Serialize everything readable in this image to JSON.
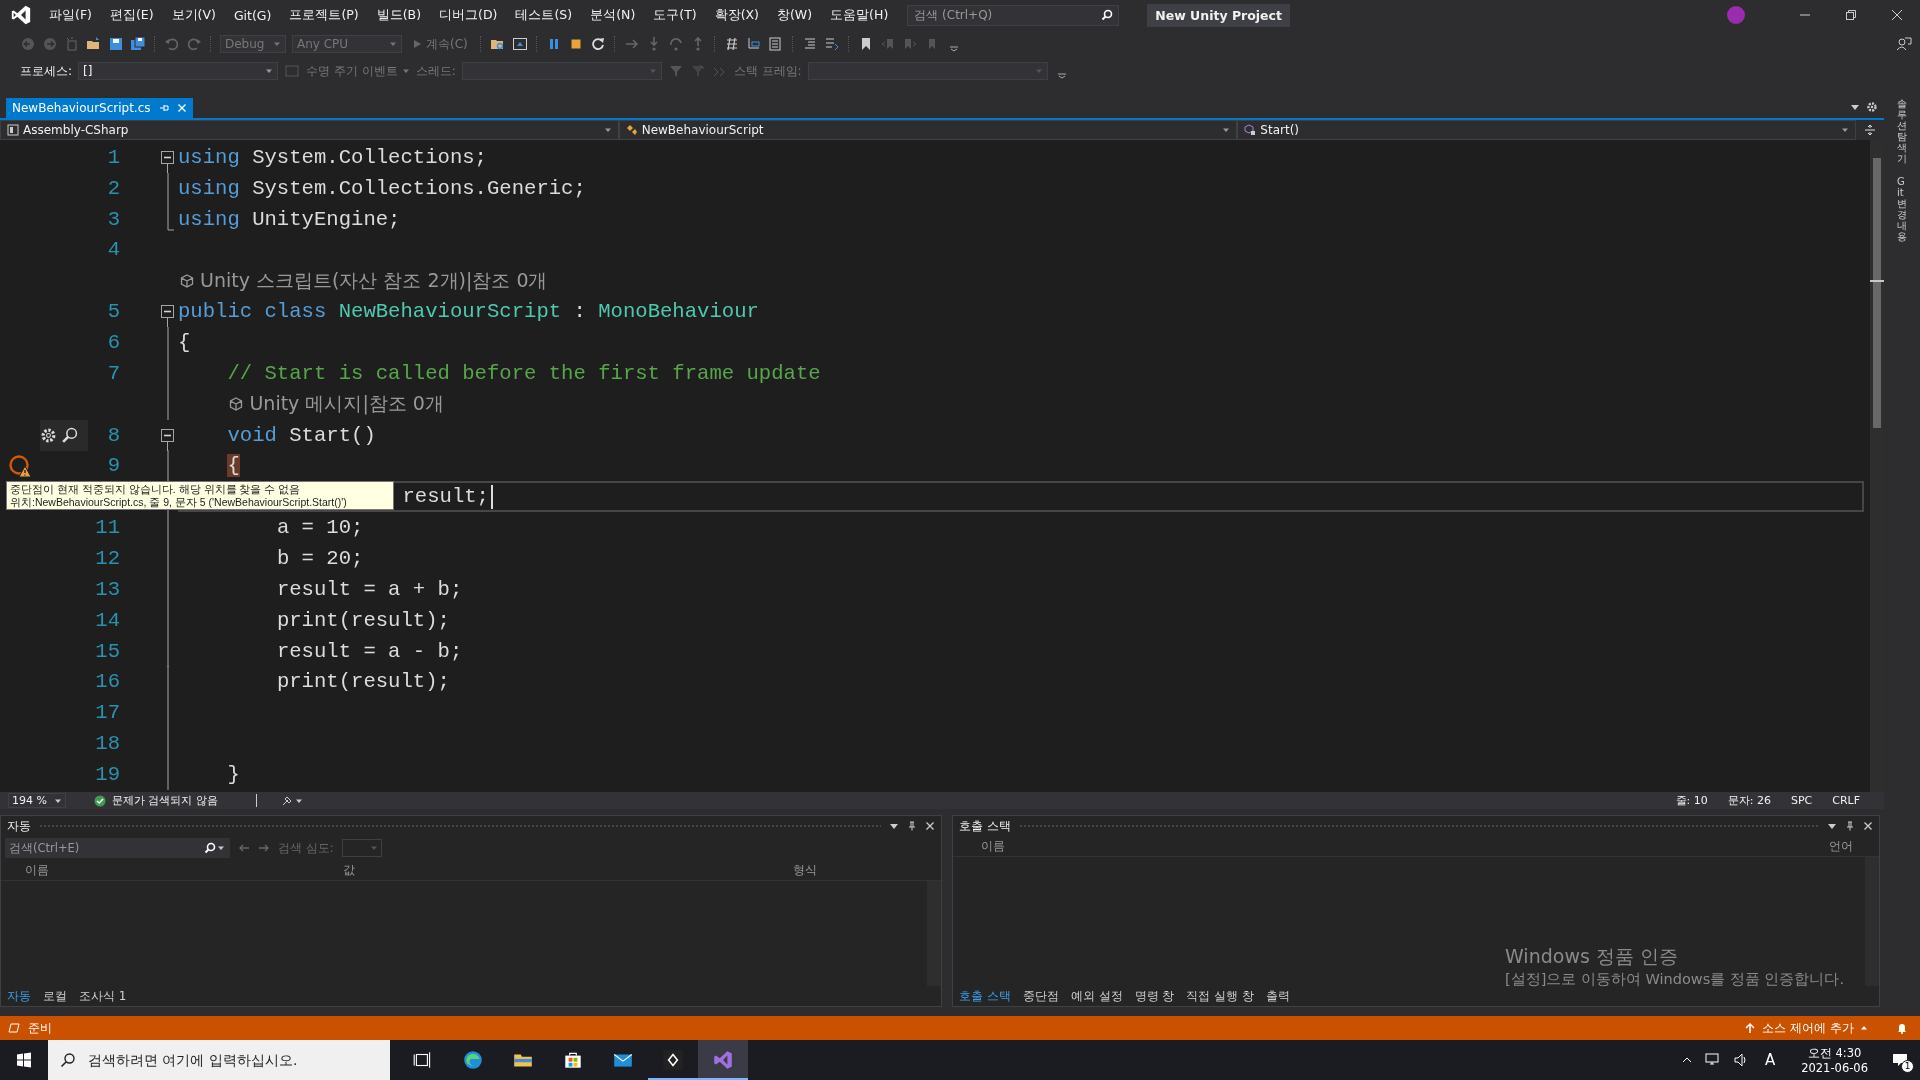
{
  "menu": {
    "items": [
      "파일(F)",
      "편집(E)",
      "보기(V)",
      "Git(G)",
      "프로젝트(P)",
      "빌드(B)",
      "디버그(D)",
      "테스트(S)",
      "분석(N)",
      "도구(T)",
      "확장(X)",
      "창(W)",
      "도움말(H)"
    ],
    "search": {
      "placeholder": "검색 (Ctrl+Q)"
    },
    "title": "New Unity Project"
  },
  "toolbar": {
    "configuration": "Debug",
    "platform": "Any CPU",
    "continue": "계속(C)"
  },
  "debug_toolbar": {
    "process_label": "프로세스:",
    "process": "[]",
    "lifecycle": "수명 주기 이벤트",
    "thread_label": "스레드:",
    "stack_label": "스택 프레임:"
  },
  "tabs": [
    {
      "label": "NewBehaviourScript.cs",
      "selected": true
    }
  ],
  "navigation": [
    "Assembly-CSharp",
    "NewBehaviourScript",
    "Start()"
  ],
  "editor": {
    "lines": [
      {
        "kind": "start",
        "number": "1",
        "breakpoint": false,
        "actions": false,
        "current": false,
        "tokens": [
          {
            "kind": "kw",
            "text": "using"
          },
          {
            "kind": "plain",
            "text": " System.Collections;"
          }
        ]
      },
      {
        "kind": "inner",
        "number": "2",
        "breakpoint": false,
        "actions": false,
        "current": false,
        "tokens": [
          {
            "kind": "kw",
            "text": "using"
          },
          {
            "kind": "plain",
            "text": " System.Collections.Generic;"
          }
        ]
      },
      {
        "kind": "end",
        "number": "3",
        "breakpoint": false,
        "actions": false,
        "current": false,
        "tokens": [
          {
            "kind": "kw",
            "text": "using"
          },
          {
            "kind": "plain",
            "text": " UnityEngine;"
          }
        ]
      },
      {
        "kind": "plain",
        "number": "4",
        "breakpoint": false,
        "actions": false,
        "current": false
      },
      {
        "kind": "lens",
        "text": "Unity 스크립트(자산 참조 2개)|참조 0개"
      },
      {
        "kind": "start",
        "number": "5",
        "breakpoint": false,
        "actions": false,
        "current": false,
        "tokens": [
          {
            "kind": "kw",
            "text": "public class"
          },
          {
            "kind": "type",
            "text": " NewBehaviourScript"
          },
          {
            "kind": "plain",
            "text": " : "
          },
          {
            "kind": "type",
            "text": "MonoBehaviour"
          }
        ]
      },
      {
        "kind": "inner",
        "number": "6",
        "breakpoint": false,
        "actions": false,
        "current": false,
        "tokens": [
          {
            "kind": "plain",
            "text": "{"
          }
        ]
      },
      {
        "kind": "inner",
        "number": "7",
        "breakpoint": false,
        "actions": false,
        "current": false,
        "tokens": [
          {
            "kind": "comment",
            "text": "    // Start is called before the first frame update"
          }
        ]
      },
      {
        "kind": "lensinner",
        "text": "    Unity 메시지|참조 0개"
      },
      {
        "kind": "start",
        "number": "8",
        "breakpoint": false,
        "actions": true,
        "current": false,
        "tokens": [
          {
            "kind": "kw",
            "text": "    void"
          },
          {
            "kind": "plain",
            "text": " Start()"
          }
        ]
      },
      {
        "kind": "inner",
        "number": "9",
        "breakpoint": true,
        "actions": false,
        "current": false,
        "tokens": [
          {
            "kind": "match",
            "text": "    {"
          }
        ]
      },
      {
        "kind": "inner",
        "breakpoint": false,
        "actions": false,
        "current": true,
        "tokens": [
          {
            "kind": "plain",
            "text": "                  result;"
          }
        ]
      },
      {
        "kind": "inner",
        "number": "11",
        "breakpoint": false,
        "actions": false,
        "current": false,
        "tokens": [
          {
            "kind": "plain",
            "text": "        a = 10;"
          }
        ]
      },
      {
        "kind": "inner",
        "number": "12",
        "breakpoint": false,
        "actions": false,
        "current": false,
        "tokens": [
          {
            "kind": "plain",
            "text": "        b = 20;"
          }
        ]
      },
      {
        "kind": "inner",
        "number": "13",
        "breakpoint": false,
        "actions": false,
        "current": false,
        "tokens": [
          {
            "kind": "plain",
            "text": "        result = a + b;"
          }
        ]
      },
      {
        "kind": "inner",
        "number": "14",
        "breakpoint": false,
        "actions": false,
        "current": false,
        "tokens": [
          {
            "kind": "plain",
            "text": "        print(result);"
          }
        ]
      },
      {
        "kind": "inner",
        "number": "15",
        "breakpoint": false,
        "actions": false,
        "current": false,
        "tokens": [
          {
            "kind": "plain",
            "text": "        result = a - b;"
          }
        ]
      },
      {
        "kind": "inner",
        "number": "16",
        "breakpoint": false,
        "actions": false,
        "current": false,
        "tokens": [
          {
            "kind": "plain",
            "text": "        print(result);"
          }
        ]
      },
      {
        "kind": "inner",
        "number": "17",
        "breakpoint": false,
        "actions": false,
        "current": false
      },
      {
        "kind": "inner",
        "number": "18",
        "breakpoint": false,
        "actions": false,
        "current": false
      },
      {
        "kind": "inner",
        "number": "19",
        "breakpoint": false,
        "actions": false,
        "current": false,
        "tokens": [
          {
            "kind": "plain",
            "text": "    }"
          }
        ]
      }
    ],
    "tooltip": {
      "message": "중단점이 현재 적중되지 않습니다. 해당 위치를 찾을 수 없음",
      "location": "위치:NewBehaviourScript.cs, 줄 9, 문자 5 ('NewBehaviourScript.Start()')"
    }
  },
  "editor_status": {
    "zoom": "194 %",
    "issues": "문제가 검색되지 않음",
    "line": "줄: 10",
    "column": "문자: 26",
    "whitespace": "SPC",
    "line_ending": "CRLF"
  },
  "side_tabs": [
    "솔루션 탐색기",
    "Git 변경 내용"
  ],
  "autos_panel": {
    "title": "자동",
    "search": {
      "placeholder": "검색(Ctrl+E)"
    },
    "depth_label": "검색 심도:",
    "columns": [
      "이름",
      "값",
      "형식"
    ],
    "tabs": [
      {
        "label": "자동",
        "selected": true
      },
      {
        "label": "로컬",
        "selected": false
      },
      {
        "label": "조사식 1",
        "selected": false
      }
    ]
  },
  "call_stack_panel": {
    "title": "호출 스택",
    "columns": [
      "이름",
      "언어"
    ],
    "tabs": [
      {
        "label": "호출 스택",
        "selected": true
      },
      {
        "label": "중단점",
        "selected": false
      },
      {
        "label": "예외 설정",
        "selected": false
      },
      {
        "label": "명령 창",
        "selected": false
      },
      {
        "label": "직접 실행 창",
        "selected": false
      },
      {
        "label": "출력",
        "selected": false
      }
    ]
  },
  "activation": {
    "title": "Windows 정품 인증",
    "message": "[설정]으로 이동하여 Windows를 정품 인증합니다."
  },
  "status_bar": {
    "state": "준비",
    "source_control": "소스 제어에 추가"
  },
  "taskbar": {
    "search": {
      "placeholder": "검색하려면 여기에 입력하십시오."
    },
    "ime": "A",
    "time": "오전 4:30",
    "date": "2021-06-06",
    "notifications": "1"
  }
}
